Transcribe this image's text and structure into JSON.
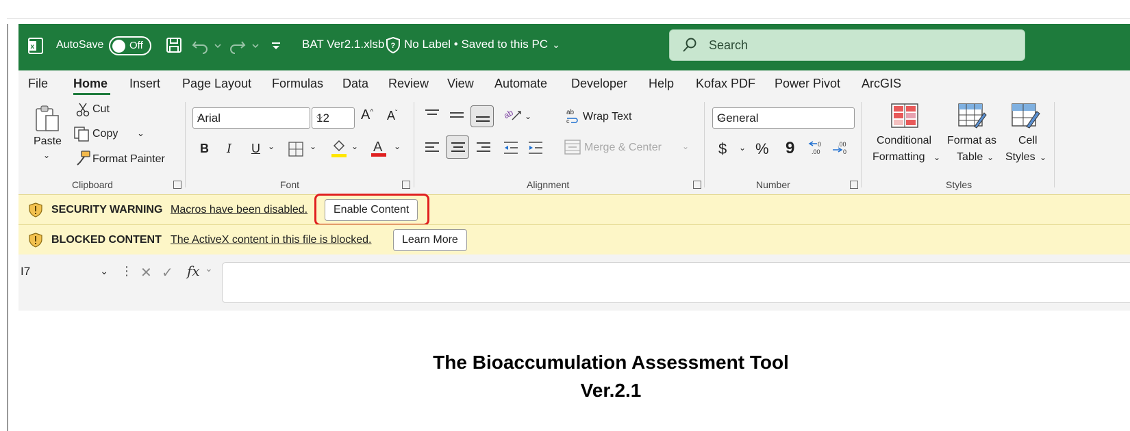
{
  "titlebar": {
    "autosave_label": "AutoSave",
    "autosave_state": "Off",
    "filename": "BAT Ver2.1.xlsb",
    "sensitivity": "No Label • Saved to this PC",
    "search_placeholder": "Search",
    "accent_color": "#1e7b3c"
  },
  "menu": {
    "tabs": [
      "File",
      "Home",
      "Insert",
      "Page Layout",
      "Formulas",
      "Data",
      "Review",
      "View",
      "Automate",
      "Developer",
      "Help",
      "Kofax PDF",
      "Power Pivot",
      "ArcGIS"
    ],
    "active": "Home"
  },
  "ribbon": {
    "clipboard": {
      "label": "Clipboard",
      "paste": "Paste",
      "cut": "Cut",
      "copy": "Copy",
      "format_painter": "Format Painter"
    },
    "font": {
      "label": "Font",
      "font_name": "Arial",
      "font_size": "12",
      "bold": "B",
      "italic": "I",
      "underline": "U"
    },
    "alignment": {
      "label": "Alignment",
      "wrap_text": "Wrap Text",
      "merge_center": "Merge & Center"
    },
    "number": {
      "label": "Number",
      "format": "General",
      "currency": "$",
      "percent": "%",
      "comma": "9"
    },
    "styles": {
      "label": "Styles",
      "conditional_1": "Conditional",
      "conditional_2": "Formatting",
      "format_table_1": "Format as",
      "format_table_2": "Table",
      "cell_styles_1": "Cell",
      "cell_styles_2": "Styles"
    }
  },
  "security_bar": {
    "title": "SECURITY WARNING",
    "message": "Macros have been disabled.",
    "button": "Enable Content"
  },
  "blocked_bar": {
    "title": "BLOCKED CONTENT",
    "message": "The ActiveX content in this file is blocked.",
    "button": "Learn More"
  },
  "formula_bar": {
    "name_box": "I7",
    "fx": "fx",
    "formula": ""
  },
  "sheet": {
    "title_line1": "The Bioaccumulation Assessment Tool",
    "title_line2": "Ver.2.1"
  }
}
